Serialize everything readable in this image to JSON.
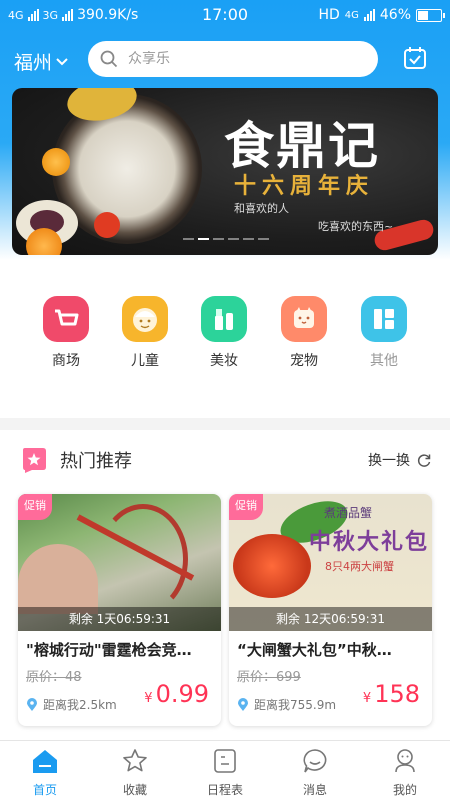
{
  "status_bar": {
    "net1": "4G",
    "net2": "3G",
    "speed": "390.9K/s",
    "time": "17:00",
    "hd": "HD",
    "net3": "4G",
    "battery": "46%",
    "battery_level": 0.46
  },
  "header": {
    "city": "福州",
    "search_placeholder": "众享乐",
    "calendar_icon": "calendar-check-icon"
  },
  "banner": {
    "title": "食鼎记",
    "subtitle": "十六周年庆",
    "line1": "和喜欢的人",
    "line2": "吃喜欢的东西~",
    "page_count": 6,
    "active_page": 1
  },
  "categories": [
    {
      "label": "商场",
      "icon": "shopping-cart-icon",
      "color": "#f04a6a"
    },
    {
      "label": "儿童",
      "icon": "child-face-icon",
      "color": "#f7b52c"
    },
    {
      "label": "美妆",
      "icon": "cosmetics-icon",
      "color": "#2cd39a"
    },
    {
      "label": "宠物",
      "icon": "pet-icon",
      "color": "#ff8a6a"
    },
    {
      "label": "其他",
      "icon": "grid-icon",
      "color": "#3ec3e8"
    }
  ],
  "recommend": {
    "title": "热门推荐",
    "swap_label": "换一换",
    "items": [
      {
        "tag": "促销",
        "remaining": "剩余 1天06:59:31",
        "name": "\"榕城行动\"雷霆枪会竞…",
        "original_price": "原价：48",
        "distance": "距离我2.5km",
        "currency": "¥",
        "price": "0.99"
      },
      {
        "tag": "促销",
        "remaining": "剩余 12天06:59:31",
        "name": "“大闸蟹大礼包”中秋…",
        "original_price": "原价：699",
        "distance": "距离我755.9m",
        "currency": "¥",
        "price": "158",
        "poster_top": "煮酒品蟹",
        "poster_title": "中秋大礼包",
        "poster_sub": "8只4两大闸蟹"
      }
    ]
  },
  "tabbar": [
    {
      "label": "首页",
      "icon": "home-icon",
      "active": true
    },
    {
      "label": "收藏",
      "icon": "star-icon",
      "active": false
    },
    {
      "label": "日程表",
      "icon": "schedule-icon",
      "active": false
    },
    {
      "label": "消息",
      "icon": "message-icon",
      "active": false
    },
    {
      "label": "我的",
      "icon": "profile-icon",
      "active": false
    }
  ],
  "colors": {
    "accent": "#1a9bf0",
    "price": "#ff3355",
    "tag": "#ff6b9a"
  }
}
